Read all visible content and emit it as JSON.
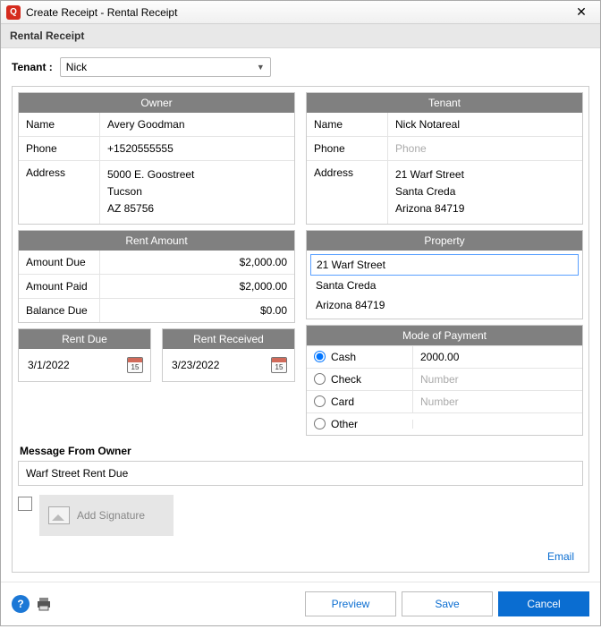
{
  "window": {
    "title": "Create Receipt - Rental Receipt"
  },
  "subtitle": "Rental Receipt",
  "tenant_label": "Tenant :",
  "tenant_selected": "Nick",
  "owner": {
    "header": "Owner",
    "name_label": "Name",
    "name": "Avery Goodman",
    "phone_label": "Phone",
    "phone": "+1520555555",
    "address_label": "Address",
    "address1": "5000 E. Goostreet",
    "address2": "Tucson",
    "address3": "AZ    85756"
  },
  "tenant": {
    "header": "Tenant",
    "name_label": "Name",
    "name": "Nick Notareal",
    "phone_label": "Phone",
    "phone_placeholder": "Phone",
    "address_label": "Address",
    "address1": "21 Warf Street",
    "address2": "Santa Creda",
    "address3": "Arizona    84719"
  },
  "rent": {
    "header": "Rent Amount",
    "due_label": "Amount Due",
    "due": "$2,000.00",
    "paid_label": "Amount Paid",
    "paid": "$2,000.00",
    "balance_label": "Balance Due",
    "balance": "$0.00"
  },
  "rent_due": {
    "header": "Rent Due",
    "date": "3/1/2022",
    "cal_num": "15"
  },
  "rent_received": {
    "header": "Rent Received",
    "date": "3/23/2022",
    "cal_num": "15"
  },
  "property": {
    "header": "Property",
    "line1": "21 Warf Street",
    "line2": "Santa Creda",
    "line3": "Arizona    84719"
  },
  "payment": {
    "header": "Mode of Payment",
    "cash": "Cash",
    "cash_value": "2000.00",
    "check": "Check",
    "check_placeholder": "Number",
    "card": "Card",
    "card_placeholder": "Number",
    "other": "Other"
  },
  "message": {
    "label": "Message From Owner",
    "value": "Warf Street Rent Due"
  },
  "signature": {
    "label": "Add Signature"
  },
  "email": "Email",
  "buttons": {
    "preview": "Preview",
    "save": "Save",
    "cancel": "Cancel"
  }
}
